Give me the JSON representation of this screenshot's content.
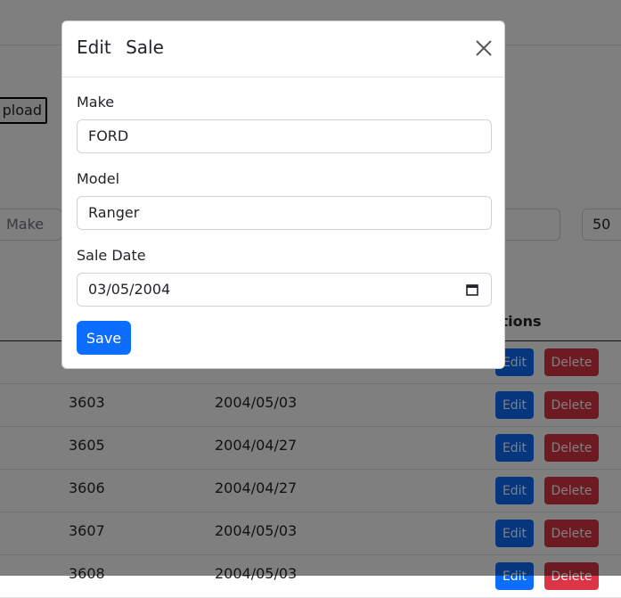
{
  "background": {
    "upload_label": "pload",
    "filter_make_placeholder": "Make",
    "page_size": "50",
    "actions_header": "ctions",
    "rows": [
      {
        "id": "",
        "date": "",
        "edit": "Edit",
        "delete": "Delete"
      },
      {
        "id": "3603",
        "date": "2004/05/03",
        "edit": "Edit",
        "delete": "Delete"
      },
      {
        "id": "3605",
        "date": "2004/04/27",
        "edit": "Edit",
        "delete": "Delete"
      },
      {
        "id": "3606",
        "date": "2004/04/27",
        "edit": "Edit",
        "delete": "Delete"
      },
      {
        "id": "3607",
        "date": "2004/05/03",
        "edit": "Edit",
        "delete": "Delete"
      },
      {
        "id": "3608",
        "date": "2004/05/03",
        "edit": "Edit",
        "delete": "Delete"
      }
    ]
  },
  "modal": {
    "title": "Edit Sale",
    "fields": {
      "make": {
        "label": "Make",
        "value": "FORD"
      },
      "model": {
        "label": "Model",
        "value": "Ranger"
      },
      "sale_date": {
        "label": "Sale Date",
        "value": "03/05/2004"
      }
    },
    "save_label": "Save"
  },
  "colors": {
    "primary": "#0d6efd",
    "danger": "#dc3545",
    "backdrop": "rgba(0,0,0,0.5)"
  },
  "icons": {
    "close": "close-icon",
    "calendar": "calendar-icon"
  }
}
